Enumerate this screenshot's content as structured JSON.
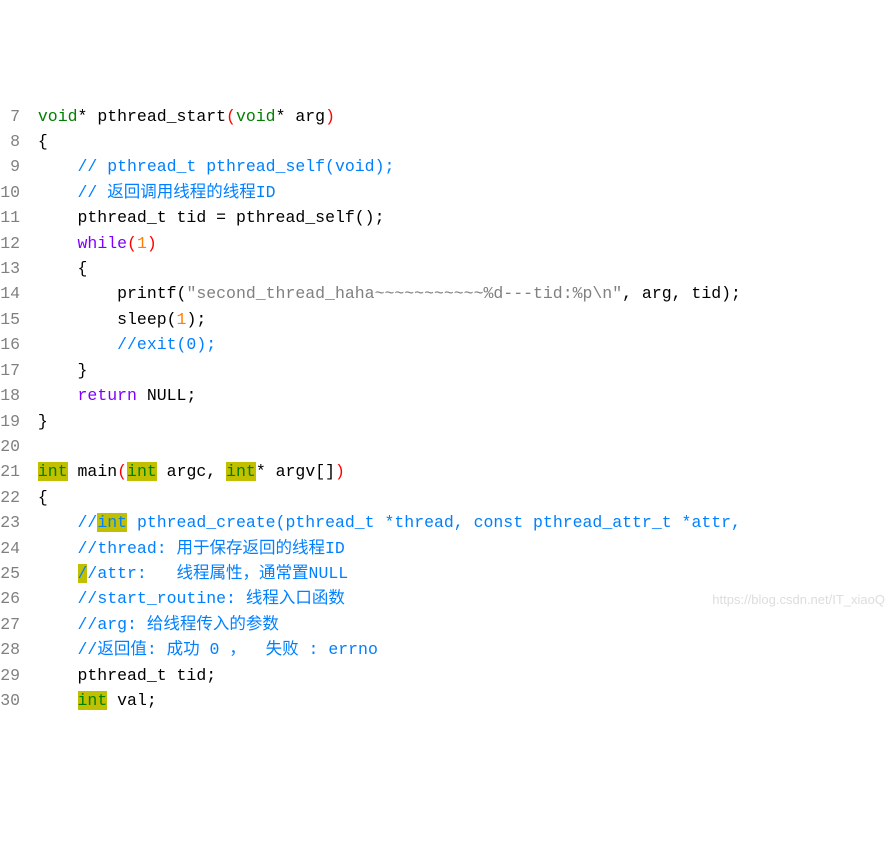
{
  "lines": [
    {
      "num": "7",
      "segments": [
        {
          "text": " ",
          "cls": ""
        },
        {
          "text": "void",
          "cls": "kw"
        },
        {
          "text": "* pthread_start",
          "cls": "ident"
        },
        {
          "text": "(",
          "cls": "paren-red"
        },
        {
          "text": "void",
          "cls": "kw"
        },
        {
          "text": "* arg",
          "cls": "ident"
        },
        {
          "text": ")",
          "cls": "paren-red"
        }
      ]
    },
    {
      "num": "8",
      "segments": [
        {
          "text": " {",
          "cls": "punct"
        }
      ]
    },
    {
      "num": "9",
      "segments": [
        {
          "text": "     ",
          "cls": ""
        },
        {
          "text": "// pthread_t pthread_self(void);",
          "cls": "comment"
        }
      ]
    },
    {
      "num": "10",
      "segments": [
        {
          "text": "     ",
          "cls": ""
        },
        {
          "text": "// 返回调用线程的线程ID",
          "cls": "comment"
        }
      ]
    },
    {
      "num": "11",
      "segments": [
        {
          "text": "     pthread_t tid ",
          "cls": "ident"
        },
        {
          "text": "=",
          "cls": "punct"
        },
        {
          "text": " pthread_self",
          "cls": "ident"
        },
        {
          "text": "();",
          "cls": "punct"
        }
      ]
    },
    {
      "num": "12",
      "segments": [
        {
          "text": "     ",
          "cls": ""
        },
        {
          "text": "while",
          "cls": "type"
        },
        {
          "text": "(",
          "cls": "paren-red"
        },
        {
          "text": "1",
          "cls": "num"
        },
        {
          "text": ")",
          "cls": "paren-red"
        }
      ]
    },
    {
      "num": "13",
      "segments": [
        {
          "text": "     {",
          "cls": "punct"
        }
      ]
    },
    {
      "num": "14",
      "segments": [
        {
          "text": "         printf",
          "cls": "ident"
        },
        {
          "text": "(",
          "cls": "punct"
        },
        {
          "text": "\"second_thread_haha~~~~~~~~~~~%d---tid:%p\\n\"",
          "cls": "str"
        },
        {
          "text": ",",
          "cls": "punct"
        },
        {
          "text": " arg",
          "cls": "ident"
        },
        {
          "text": ",",
          "cls": "punct"
        },
        {
          "text": " tid",
          "cls": "ident"
        },
        {
          "text": ");",
          "cls": "punct"
        }
      ]
    },
    {
      "num": "15",
      "segments": [
        {
          "text": "         sleep",
          "cls": "ident"
        },
        {
          "text": "(",
          "cls": "punct"
        },
        {
          "text": "1",
          "cls": "num"
        },
        {
          "text": ");",
          "cls": "punct"
        }
      ]
    },
    {
      "num": "16",
      "segments": [
        {
          "text": "         ",
          "cls": ""
        },
        {
          "text": "//exit(0);",
          "cls": "comment"
        }
      ]
    },
    {
      "num": "17",
      "segments": [
        {
          "text": "     }",
          "cls": "punct"
        }
      ]
    },
    {
      "num": "18",
      "segments": [
        {
          "text": "     ",
          "cls": ""
        },
        {
          "text": "return",
          "cls": "type"
        },
        {
          "text": " ",
          "cls": ""
        },
        {
          "text": "NULL",
          "cls": "null"
        },
        {
          "text": ";",
          "cls": "punct"
        }
      ]
    },
    {
      "num": "19",
      "segments": [
        {
          "text": " }",
          "cls": "punct"
        }
      ]
    },
    {
      "num": "20",
      "segments": [
        {
          "text": "",
          "cls": ""
        }
      ]
    },
    {
      "num": "21",
      "segments": [
        {
          "text": " ",
          "cls": ""
        },
        {
          "text": "int",
          "cls": "kw hl"
        },
        {
          "text": " main",
          "cls": "ident"
        },
        {
          "text": "(",
          "cls": "paren-red"
        },
        {
          "text": "int",
          "cls": "kw hl"
        },
        {
          "text": " argc",
          "cls": "ident"
        },
        {
          "text": ",",
          "cls": "punct"
        },
        {
          "text": " ",
          "cls": ""
        },
        {
          "text": "int",
          "cls": "kw hl"
        },
        {
          "text": "* argv",
          "cls": "ident"
        },
        {
          "text": "[]",
          "cls": "punct"
        },
        {
          "text": ")",
          "cls": "paren-red"
        }
      ]
    },
    {
      "num": "22",
      "segments": [
        {
          "text": " {",
          "cls": "punct"
        }
      ]
    },
    {
      "num": "23",
      "segments": [
        {
          "text": "     ",
          "cls": ""
        },
        {
          "text": "//",
          "cls": "comment"
        },
        {
          "text": "int",
          "cls": "comment hl"
        },
        {
          "text": " pthread_create(pthread_t *thread, const pthread_attr_t *attr,",
          "cls": "comment"
        }
      ]
    },
    {
      "num": "24",
      "segments": [
        {
          "text": "     ",
          "cls": ""
        },
        {
          "text": "//thread: 用于保存返回的线程ID",
          "cls": "comment"
        }
      ]
    },
    {
      "num": "25",
      "segments": [
        {
          "text": "     ",
          "cls": ""
        },
        {
          "text": "/",
          "cls": "comment hl"
        },
        {
          "text": "/attr:   线程属性，通常置NULL",
          "cls": "comment"
        }
      ]
    },
    {
      "num": "26",
      "segments": [
        {
          "text": "     ",
          "cls": ""
        },
        {
          "text": "//start_routine: 线程入口函数",
          "cls": "comment"
        }
      ]
    },
    {
      "num": "27",
      "segments": [
        {
          "text": "     ",
          "cls": ""
        },
        {
          "text": "//arg: 给线程传入的参数",
          "cls": "comment"
        }
      ]
    },
    {
      "num": "28",
      "segments": [
        {
          "text": "     ",
          "cls": ""
        },
        {
          "text": "//返回值: 成功 0 ，  失败 : errno",
          "cls": "comment"
        }
      ]
    },
    {
      "num": "29",
      "segments": [
        {
          "text": "     pthread_t tid",
          "cls": "ident"
        },
        {
          "text": ";",
          "cls": "punct"
        }
      ]
    },
    {
      "num": "30",
      "segments": [
        {
          "text": "     ",
          "cls": ""
        },
        {
          "text": "int",
          "cls": "kw hl"
        },
        {
          "text": " val",
          "cls": "ident"
        },
        {
          "text": ";",
          "cls": "punct"
        }
      ]
    }
  ],
  "watermark": "https://blog.csdn.net/IT_xiaoQ"
}
